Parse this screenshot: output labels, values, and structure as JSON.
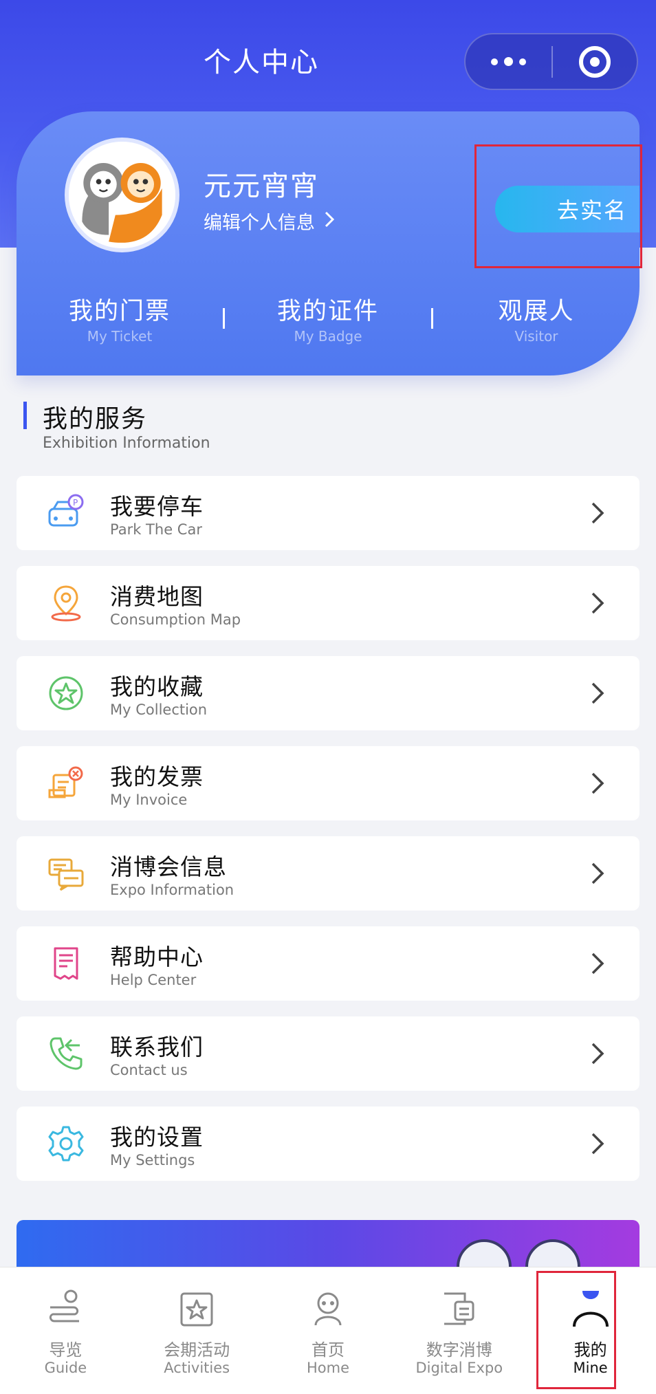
{
  "header": {
    "title": "个人中心"
  },
  "profile": {
    "name": "元元宵宵",
    "edit_label": "编辑个人信息",
    "verify_label": "去实名",
    "stats": [
      {
        "zh": "我的门票",
        "en": "My Ticket"
      },
      {
        "zh": "我的证件",
        "en": "My Badge"
      },
      {
        "zh": "观展人",
        "en": "Visitor"
      }
    ]
  },
  "services": {
    "title": "我的服务",
    "subtitle": "Exhibition Information",
    "items": [
      {
        "zh": "我要停车",
        "en": "Park The Car",
        "icon": "parking-car-icon"
      },
      {
        "zh": "消费地图",
        "en": "Consumption Map",
        "icon": "location-pin-icon"
      },
      {
        "zh": "我的收藏",
        "en": "My Collection",
        "icon": "star-circle-icon"
      },
      {
        "zh": "我的发票",
        "en": "My Invoice",
        "icon": "invoice-icon"
      },
      {
        "zh": "消博会信息",
        "en": "Expo Information",
        "icon": "chat-bubbles-icon"
      },
      {
        "zh": "帮助中心",
        "en": "Help Center",
        "icon": "document-icon"
      },
      {
        "zh": "联系我们",
        "en": "Contact us",
        "icon": "phone-call-icon"
      },
      {
        "zh": "我的设置",
        "en": "My Settings",
        "icon": "gear-icon"
      }
    ]
  },
  "tabbar": {
    "items": [
      {
        "zh": "导览",
        "en": "Guide",
        "icon": "guide-route-icon"
      },
      {
        "zh": "会期活动",
        "en": "Activities",
        "icon": "activity-star-icon"
      },
      {
        "zh": "首页",
        "en": "Home",
        "icon": "home-mascot-icon"
      },
      {
        "zh": "数字消博",
        "en": "Digital Expo",
        "icon": "digital-expo-icon"
      },
      {
        "zh": "我的",
        "en": "Mine",
        "icon": "user-icon"
      }
    ],
    "active_index": 4
  },
  "colors": {
    "accent": "#3b55f0",
    "header_gradient_top": "#3c49e8",
    "card_blue": "#5a80f2",
    "verify_button": "#27b7ee",
    "highlight_box": "#e0263b"
  }
}
